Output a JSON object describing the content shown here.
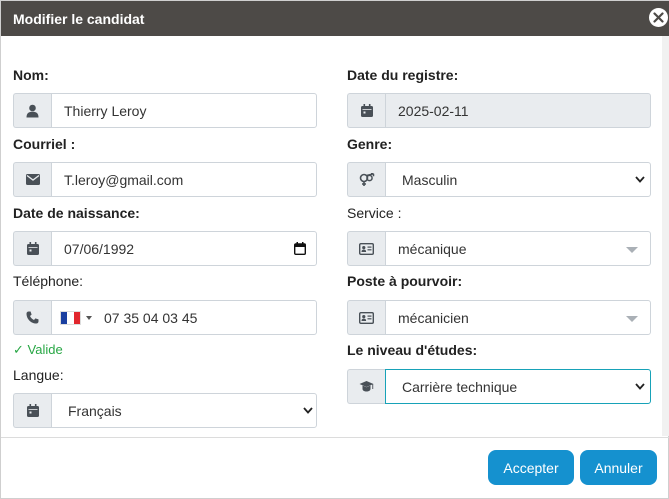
{
  "dialog": {
    "title": "Modifier le candidat",
    "close_icon": "close-icon"
  },
  "form": {
    "nom": {
      "label": "Nom:",
      "value": "Thierry Leroy",
      "icon": "user-icon"
    },
    "courriel": {
      "label": "Courriel :",
      "value": "T.leroy@gmail.com",
      "icon": "envelope-icon"
    },
    "date_naissance": {
      "label": "Date de naissance:",
      "value": "07/06/1992",
      "icon": "calendar-icon"
    },
    "telephone": {
      "label": "Téléphone:",
      "value": "07 35 04 03 45",
      "icon": "phone-icon",
      "country": "fr",
      "status": "✓ Valide"
    },
    "langue": {
      "label": "Langue:",
      "value": "Français",
      "icon": "calendar-icon"
    },
    "date_registre": {
      "label": "Date du registre:",
      "value": "2025-02-11",
      "icon": "calendar-icon"
    },
    "genre": {
      "label": "Genre:",
      "value": "Masculin",
      "icon": "gender-icon"
    },
    "service": {
      "label": "Service :",
      "value": "mécanique",
      "icon": "id-card-icon"
    },
    "poste": {
      "label": "Poste à pourvoir:",
      "value": "mécanicien",
      "icon": "id-card-icon"
    },
    "niveau": {
      "label": "Le niveau d'études:",
      "value": "Carrière technique",
      "icon": "graduation-cap-icon"
    }
  },
  "footer": {
    "accept_label": "Accepter",
    "cancel_label": "Annuler"
  },
  "colors": {
    "titlebar": "#4d4a47",
    "primary_button": "#1591cf",
    "valid": "#28a745",
    "focus_border": "#17a2b8"
  }
}
